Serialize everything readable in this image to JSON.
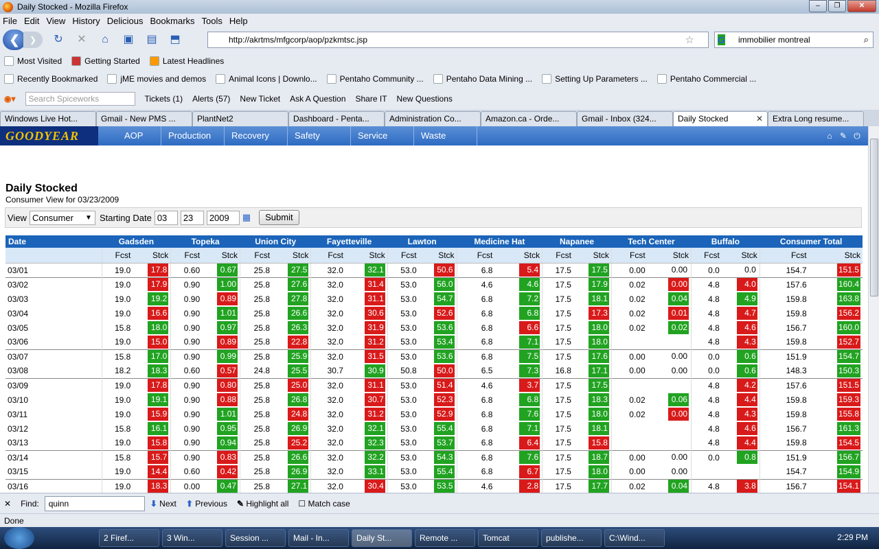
{
  "window": {
    "title": "Daily Stocked - Mozilla Firefox"
  },
  "menu": [
    "File",
    "Edit",
    "View",
    "History",
    "Delicious",
    "Bookmarks",
    "Tools",
    "Help"
  ],
  "nav": {
    "url": "http://akrtms/mfgcorp/aop/pzkmtsc.jsp",
    "search": "immobilier montreal"
  },
  "bookmarks1": [
    "Most Visited",
    "Getting Started",
    "Latest Headlines"
  ],
  "bookmarks2": [
    "Recently Bookmarked",
    "jME movies and demos",
    "Animal Icons | Downlo...",
    "Pentaho Community ...",
    "Pentaho Data Mining ...",
    "Setting Up Parameters ...",
    "Pentaho Commercial ..."
  ],
  "spiceworks": {
    "placeholder": "Search Spiceworks",
    "items": [
      "Tickets (1)",
      "Alerts (57)",
      "New Ticket",
      "Ask A Question",
      "Share IT",
      "New Questions"
    ]
  },
  "tabs": [
    "Windows Live Hot...",
    "Gmail - New PMS ...",
    "PlantNet2",
    "Dashboard - Penta...",
    "Administration Co...",
    "Amazon.ca - Orde...",
    "Gmail - Inbox (324...",
    "Daily Stocked",
    "Extra Long resume..."
  ],
  "app": {
    "logo": "GOODYEAR",
    "nav": [
      "AOP",
      "Production",
      "Recovery",
      "Safety",
      "Service",
      "Waste"
    ],
    "title": "Daily Stocked",
    "subtitle": "Consumer View for 03/23/2009",
    "filter": {
      "view_label": "View",
      "view_value": "Consumer",
      "start_label": "Starting Date",
      "month": "03",
      "day": "23",
      "year": "2009",
      "submit": "Submit"
    },
    "table": {
      "date_header": "Date",
      "cities": [
        "Gadsden",
        "Topeka",
        "Union City",
        "Fayetteville",
        "Lawton",
        "Medicine Hat",
        "Napanee",
        "Tech Center",
        "Buffalo",
        "Consumer Total"
      ],
      "fcst": "Fcst",
      "stck": "Stck"
    }
  },
  "rows": [
    {
      "date": "03/01",
      "grp": true,
      "v": [
        [
          "19.0",
          "17.8",
          "r"
        ],
        [
          "0.60",
          "0.67",
          "g"
        ],
        [
          "25.8",
          "27.5",
          "g"
        ],
        [
          "32.0",
          "32.1",
          "g"
        ],
        [
          "53.0",
          "50.6",
          "r"
        ],
        [
          "6.8",
          "5.4",
          "r"
        ],
        [
          "17.5",
          "17.5",
          "g"
        ],
        [
          "0.00",
          "0.00",
          ""
        ],
        [
          "0.0",
          "0.0",
          ""
        ],
        [
          "154.7",
          "151.5",
          "r"
        ]
      ]
    },
    {
      "date": "03/02",
      "grp": true,
      "v": [
        [
          "19.0",
          "17.9",
          "r"
        ],
        [
          "0.90",
          "1.00",
          "g"
        ],
        [
          "25.8",
          "27.6",
          "g"
        ],
        [
          "32.0",
          "31.4",
          "r"
        ],
        [
          "53.0",
          "56.0",
          "g"
        ],
        [
          "4.6",
          "4.6",
          "g"
        ],
        [
          "17.5",
          "17.9",
          "g"
        ],
        [
          "0.02",
          "0.00",
          "r"
        ],
        [
          "4.8",
          "4.0",
          "r"
        ],
        [
          "157.6",
          "160.4",
          "g"
        ]
      ]
    },
    {
      "date": "03/03",
      "grp": false,
      "v": [
        [
          "19.0",
          "19.2",
          "g"
        ],
        [
          "0.90",
          "0.89",
          "r"
        ],
        [
          "25.8",
          "27.8",
          "g"
        ],
        [
          "32.0",
          "31.1",
          "r"
        ],
        [
          "53.0",
          "54.7",
          "g"
        ],
        [
          "6.8",
          "7.2",
          "g"
        ],
        [
          "17.5",
          "18.1",
          "g"
        ],
        [
          "0.02",
          "0.04",
          "g"
        ],
        [
          "4.8",
          "4.9",
          "g"
        ],
        [
          "159.8",
          "163.8",
          "g"
        ]
      ]
    },
    {
      "date": "03/04",
      "grp": false,
      "v": [
        [
          "19.0",
          "16.6",
          "r"
        ],
        [
          "0.90",
          "1.01",
          "g"
        ],
        [
          "25.8",
          "26.6",
          "g"
        ],
        [
          "32.0",
          "30.6",
          "r"
        ],
        [
          "53.0",
          "52.6",
          "r"
        ],
        [
          "6.8",
          "6.8",
          "g"
        ],
        [
          "17.5",
          "17.3",
          "r"
        ],
        [
          "0.02",
          "0.01",
          "r"
        ],
        [
          "4.8",
          "4.7",
          "r"
        ],
        [
          "159.8",
          "156.2",
          "r"
        ]
      ]
    },
    {
      "date": "03/05",
      "grp": false,
      "v": [
        [
          "15.8",
          "18.0",
          "g"
        ],
        [
          "0.90",
          "0.97",
          "g"
        ],
        [
          "25.8",
          "26.3",
          "g"
        ],
        [
          "32.0",
          "31.9",
          "r"
        ],
        [
          "53.0",
          "53.6",
          "g"
        ],
        [
          "6.8",
          "6.6",
          "r"
        ],
        [
          "17.5",
          "18.0",
          "g"
        ],
        [
          "0.02",
          "0.02",
          "g"
        ],
        [
          "4.8",
          "4.6",
          "r"
        ],
        [
          "156.7",
          "160.0",
          "g"
        ]
      ]
    },
    {
      "date": "03/06",
      "grp": false,
      "v": [
        [
          "19.0",
          "15.0",
          "r"
        ],
        [
          "0.90",
          "0.89",
          "r"
        ],
        [
          "25.8",
          "22.8",
          "r"
        ],
        [
          "32.0",
          "31.2",
          "r"
        ],
        [
          "53.0",
          "53.4",
          "g"
        ],
        [
          "6.8",
          "7.1",
          "g"
        ],
        [
          "17.5",
          "18.0",
          "g"
        ],
        [
          "",
          "",
          ""
        ],
        [
          "4.8",
          "4.3",
          "r"
        ],
        [
          "159.8",
          "152.7",
          "r"
        ]
      ]
    },
    {
      "date": "03/07",
      "grp": true,
      "v": [
        [
          "15.8",
          "17.0",
          "g"
        ],
        [
          "0.90",
          "0.99",
          "g"
        ],
        [
          "25.8",
          "25.9",
          "g"
        ],
        [
          "32.0",
          "31.5",
          "r"
        ],
        [
          "53.0",
          "53.6",
          "g"
        ],
        [
          "6.8",
          "7.5",
          "g"
        ],
        [
          "17.5",
          "17.6",
          "g"
        ],
        [
          "0.00",
          "0.00",
          ""
        ],
        [
          "0.0",
          "0.6",
          "g"
        ],
        [
          "151.9",
          "154.7",
          "g"
        ]
      ]
    },
    {
      "date": "03/08",
      "grp": false,
      "v": [
        [
          "18.2",
          "18.3",
          "g"
        ],
        [
          "0.60",
          "0.57",
          "r"
        ],
        [
          "24.8",
          "25.5",
          "g"
        ],
        [
          "30.7",
          "30.9",
          "g"
        ],
        [
          "50.8",
          "50.0",
          "r"
        ],
        [
          "6.5",
          "7.3",
          "g"
        ],
        [
          "16.8",
          "17.1",
          "g"
        ],
        [
          "0.00",
          "0.00",
          ""
        ],
        [
          "0.0",
          "0.6",
          "g"
        ],
        [
          "148.3",
          "150.3",
          "g"
        ]
      ]
    },
    {
      "date": "03/09",
      "grp": true,
      "v": [
        [
          "19.0",
          "17.8",
          "r"
        ],
        [
          "0.90",
          "0.80",
          "r"
        ],
        [
          "25.8",
          "25.0",
          "r"
        ],
        [
          "32.0",
          "31.1",
          "r"
        ],
        [
          "53.0",
          "51.4",
          "r"
        ],
        [
          "4.6",
          "3.7",
          "r"
        ],
        [
          "17.5",
          "17.5",
          "g"
        ],
        [
          "",
          "",
          ""
        ],
        [
          "4.8",
          "4.2",
          "r"
        ],
        [
          "157.6",
          "151.5",
          "r"
        ]
      ]
    },
    {
      "date": "03/10",
      "grp": false,
      "v": [
        [
          "19.0",
          "19.1",
          "g"
        ],
        [
          "0.90",
          "0.88",
          "r"
        ],
        [
          "25.8",
          "26.8",
          "g"
        ],
        [
          "32.0",
          "30.7",
          "r"
        ],
        [
          "53.0",
          "52.3",
          "r"
        ],
        [
          "6.8",
          "6.8",
          "g"
        ],
        [
          "17.5",
          "18.3",
          "g"
        ],
        [
          "0.02",
          "0.06",
          "g"
        ],
        [
          "4.8",
          "4.4",
          "r"
        ],
        [
          "159.8",
          "159.3",
          "r"
        ]
      ]
    },
    {
      "date": "03/11",
      "grp": false,
      "v": [
        [
          "19.0",
          "15.9",
          "r"
        ],
        [
          "0.90",
          "1.01",
          "g"
        ],
        [
          "25.8",
          "24.8",
          "r"
        ],
        [
          "32.0",
          "31.2",
          "r"
        ],
        [
          "53.0",
          "52.9",
          "r"
        ],
        [
          "6.8",
          "7.6",
          "g"
        ],
        [
          "17.5",
          "18.0",
          "g"
        ],
        [
          "0.02",
          "0.00",
          "r"
        ],
        [
          "4.8",
          "4.3",
          "r"
        ],
        [
          "159.8",
          "155.8",
          "r"
        ]
      ]
    },
    {
      "date": "03/12",
      "grp": false,
      "v": [
        [
          "15.8",
          "16.1",
          "g"
        ],
        [
          "0.90",
          "0.95",
          "g"
        ],
        [
          "25.8",
          "26.9",
          "g"
        ],
        [
          "32.0",
          "32.1",
          "g"
        ],
        [
          "53.0",
          "55.4",
          "g"
        ],
        [
          "6.8",
          "7.1",
          "g"
        ],
        [
          "17.5",
          "18.1",
          "g"
        ],
        [
          "",
          "",
          ""
        ],
        [
          "4.8",
          "4.6",
          "r"
        ],
        [
          "156.7",
          "161.3",
          "g"
        ]
      ]
    },
    {
      "date": "03/13",
      "grp": false,
      "v": [
        [
          "19.0",
          "15.8",
          "r"
        ],
        [
          "0.90",
          "0.94",
          "g"
        ],
        [
          "25.8",
          "25.2",
          "r"
        ],
        [
          "32.0",
          "32.3",
          "g"
        ],
        [
          "53.0",
          "53.7",
          "g"
        ],
        [
          "6.8",
          "6.4",
          "r"
        ],
        [
          "17.5",
          "15.8",
          "r"
        ],
        [
          "",
          "",
          ""
        ],
        [
          "4.8",
          "4.4",
          "r"
        ],
        [
          "159.8",
          "154.5",
          "r"
        ]
      ]
    },
    {
      "date": "03/14",
      "grp": true,
      "v": [
        [
          "15.8",
          "15.7",
          "r"
        ],
        [
          "0.90",
          "0.83",
          "r"
        ],
        [
          "25.8",
          "26.6",
          "g"
        ],
        [
          "32.0",
          "32.2",
          "g"
        ],
        [
          "53.0",
          "54.3",
          "g"
        ],
        [
          "6.8",
          "7.6",
          "g"
        ],
        [
          "17.5",
          "18.7",
          "g"
        ],
        [
          "0.00",
          "0.00",
          ""
        ],
        [
          "0.0",
          "0.8",
          "g"
        ],
        [
          "151.9",
          "156.7",
          "g"
        ]
      ]
    },
    {
      "date": "03/15",
      "grp": false,
      "v": [
        [
          "19.0",
          "14.4",
          "r"
        ],
        [
          "0.60",
          "0.42",
          "r"
        ],
        [
          "25.8",
          "26.9",
          "g"
        ],
        [
          "32.0",
          "33.1",
          "g"
        ],
        [
          "53.0",
          "55.4",
          "g"
        ],
        [
          "6.8",
          "6.7",
          "r"
        ],
        [
          "17.5",
          "18.0",
          "g"
        ],
        [
          "0.00",
          "0.00",
          ""
        ],
        [
          "",
          "",
          ""
        ],
        [
          "154.7",
          "154.9",
          "g"
        ]
      ]
    },
    {
      "date": "03/16",
      "grp": true,
      "v": [
        [
          "19.0",
          "18.3",
          "r"
        ],
        [
          "0.00",
          "0.47",
          "g"
        ],
        [
          "25.8",
          "27.1",
          "g"
        ],
        [
          "32.0",
          "30.4",
          "r"
        ],
        [
          "53.0",
          "53.5",
          "g"
        ],
        [
          "4.6",
          "2.8",
          "r"
        ],
        [
          "17.5",
          "17.7",
          "g"
        ],
        [
          "0.02",
          "0.04",
          "g"
        ],
        [
          "4.8",
          "3.8",
          "r"
        ],
        [
          "156.7",
          "154.1",
          "r"
        ]
      ]
    }
  ],
  "find": {
    "label": "Find:",
    "value": "quinn",
    "next": "Next",
    "previous": "Previous",
    "highlight": "Highlight all",
    "matchcase": "Match case"
  },
  "status": "Done",
  "taskbar": [
    "2 Firef...",
    "3 Win...",
    "Session ...",
    "Mail - In...",
    "Daily St...",
    "Remote ...",
    "Tomcat",
    "publishe...",
    "C:\\Wind..."
  ],
  "clock": "2:29 PM"
}
